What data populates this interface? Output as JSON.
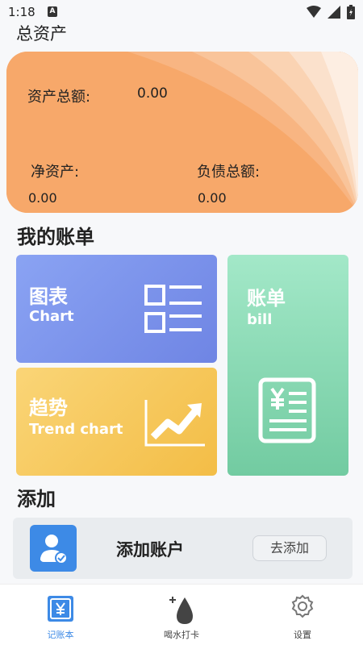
{
  "status_bar": {
    "time": "1:18",
    "notif_letter": "A"
  },
  "header": {
    "title": "总资产"
  },
  "asset_card": {
    "total_label": "资产总额:",
    "total_value": "0.00",
    "net_label": "净资产:",
    "net_value": "0.00",
    "debt_label": "负债总额:",
    "debt_value": "0.00"
  },
  "bills": {
    "title": "我的账单",
    "chart": {
      "cn": "图表",
      "en": "Chart",
      "icon": "list-chart-icon"
    },
    "trend": {
      "cn": "趋势",
      "en": "Trend chart",
      "icon": "trend-up-icon"
    },
    "bill": {
      "cn": "账单",
      "en": "bill",
      "icon": "receipt-icon"
    }
  },
  "add": {
    "title": "添加",
    "row_label": "添加账户",
    "button_label": "去添加",
    "icon": "add-user-icon"
  },
  "nav": {
    "items": [
      {
        "label": "记账本",
        "icon": "yen-book-icon",
        "active": true
      },
      {
        "label": "喝水打卡",
        "icon": "water-drop-icon",
        "active": false
      },
      {
        "label": "设置",
        "icon": "gear-icon",
        "active": false
      }
    ]
  },
  "colors": {
    "accent": "#3d8ae6",
    "card_orange": "#f7a86a",
    "chart_blue": "#7a90ea",
    "trend_yellow": "#f5c65a",
    "bill_green": "#8ad9b4"
  }
}
